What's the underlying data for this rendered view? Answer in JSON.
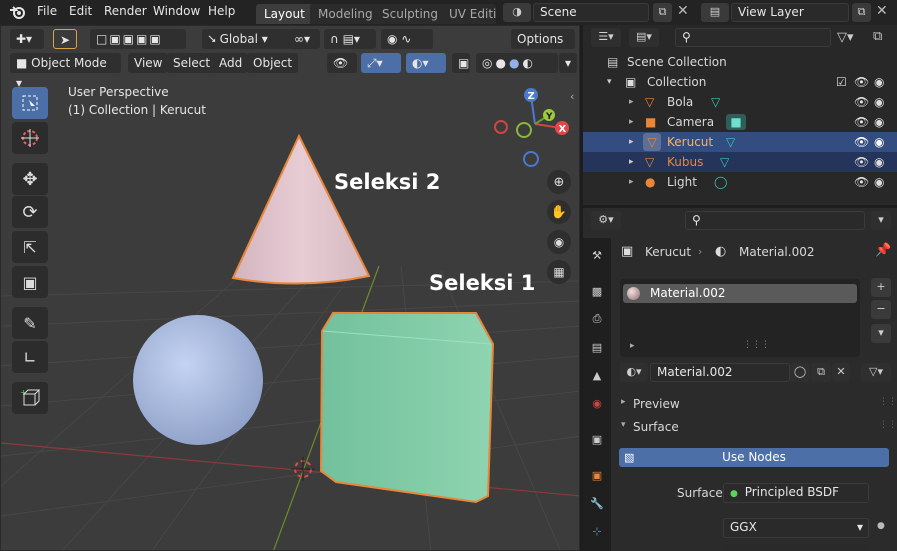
{
  "menubar": {
    "items": [
      "File",
      "Edit",
      "Render",
      "Window",
      "Help"
    ]
  },
  "workspaces": {
    "tabs": [
      "Layout",
      "Modeling",
      "Sculpting",
      "UV Editir"
    ],
    "active": "Layout"
  },
  "scene": {
    "label": "Scene"
  },
  "view_layer": {
    "label": "View Layer"
  },
  "viewport_header": {
    "orientation": "Global",
    "options": "Options",
    "mode": "Object Mode",
    "menus": [
      "View",
      "Select",
      "Add",
      "Object"
    ]
  },
  "viewport": {
    "info_line1": "User Perspective",
    "info_line2": "(1) Collection | Kerucut",
    "annotation1": "Seleksi 2",
    "annotation2": "Seleksi 1",
    "gizmo": {
      "z": "Z",
      "y": "Y",
      "x": "X"
    }
  },
  "outliner": {
    "scene_collection": "Scene Collection",
    "collection": "Collection",
    "objects": [
      {
        "name": "Bola",
        "state": "normal"
      },
      {
        "name": "Camera",
        "state": "normal"
      },
      {
        "name": "Kerucut",
        "state": "active"
      },
      {
        "name": "Kubus",
        "state": "selected"
      },
      {
        "name": "Light",
        "state": "normal"
      }
    ]
  },
  "properties": {
    "object": "Kerucut",
    "material": "Material.002",
    "slot": "Material.002",
    "datablock": "Material.002",
    "panel_preview": "Preview",
    "panel_surface": "Surface",
    "use_nodes": "Use Nodes",
    "surface_label": "Surface",
    "surface_value": "Principled BSDF",
    "distribution": "GGX"
  },
  "colors": {
    "selected_orange": "#e8863a",
    "active_row": "#334d80",
    "accent_blue": "#4d6fa8"
  }
}
